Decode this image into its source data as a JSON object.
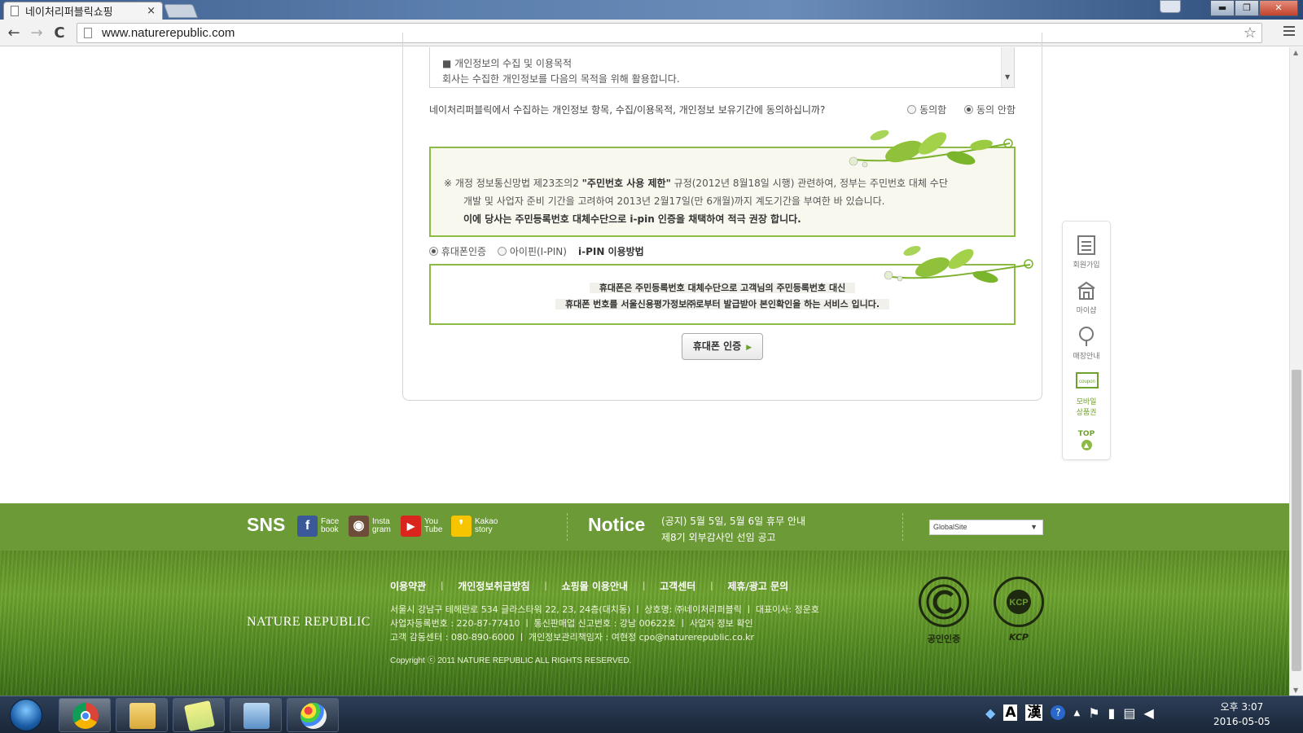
{
  "browser": {
    "tab_title": "네이처리퍼블릭쇼핑",
    "tab_close": "×",
    "url": "www.naturerepublic.com",
    "back": "←",
    "forward": "→",
    "reload": "C",
    "star": "☆"
  },
  "window": {
    "minimize": "▬",
    "maximize": "❐",
    "close": "✕"
  },
  "terms": {
    "heading": "■ 개인정보의 수집 및 이용목적",
    "body": "회사는 수집한 개인정보를 다음의 목적을 위해 활용합니다."
  },
  "agreement": {
    "question": "네이처리퍼블릭에서 수집하는 개인정보 항목, 수집/이용목적, 개인정보 보유기간에 동의하십니까?",
    "agree_label": "동의함",
    "disagree_label": "동의 안함",
    "selected": "disagree"
  },
  "notice_box": {
    "line1_prefix": "※ 개정 정보통신망법 제23조의2 ",
    "line1_bold": "\"주민번호 사용 제한\"",
    "line1_suffix": " 규정(2012년 8월18일 시행) 관련하여, 정부는 주민번호 대체 수단",
    "line2": "개발 및 사업자 준비 기간을 고려하여 2013년 2월17일(만 6개월)까지 계도기간을 부여한 바 있습니다.",
    "line3": "이에 당사는 주민등록번호 대체수단으로 i-pin 인증을 채택하여 적극 권장 합니다."
  },
  "methods": {
    "phone_label": "휴대폰인증",
    "ipin_label": "아이핀(I-PIN)",
    "guide_link": "i-PIN 이용방법",
    "selected": "phone"
  },
  "phone_box": {
    "line1": "휴대폰은 주민등록번호 대체수단으로 고객님의 주민등록번호 대신",
    "line2": "휴대폰 번호를 서울신용평가정보㈜로부터 발급받아 본인확인을 하는 서비스 입니다."
  },
  "auth_button": {
    "label": "휴대폰 인증",
    "arrow": "▶"
  },
  "quickbar": {
    "items": [
      {
        "label": "회원가입",
        "icon": "list-icon"
      },
      {
        "label": "마이샵",
        "icon": "store-icon"
      },
      {
        "label": "매장안내",
        "icon": "tree-icon"
      },
      {
        "label": "모바일\n상품권",
        "icon": "coupon-icon",
        "coupon_text": "coupon"
      }
    ],
    "top_label": "TOP",
    "top_arrow": "▲"
  },
  "footer": {
    "sns_title": "SNS",
    "sns": [
      {
        "name": "facebook",
        "glyph": "f",
        "text1": "Face",
        "text2": "book",
        "color": "#3b5998"
      },
      {
        "name": "instagram",
        "glyph": "◉",
        "text1": "Insta",
        "text2": "gram",
        "color": "#6e4c3a"
      },
      {
        "name": "youtube",
        "glyph": "▶",
        "text1": "You",
        "text2": "Tube",
        "color": "#d9251d"
      },
      {
        "name": "kakaostory",
        "glyph": "❜",
        "text1": "Kakao",
        "text2": "story",
        "color": "#f6c500"
      }
    ],
    "notice_title": "Notice",
    "notices": [
      "(공지) 5월 5일, 5월 6일 휴무 안내",
      "제8기 외부감사인 선임 공고"
    ],
    "global_site": "GlobalSite",
    "global_arrow": "▼",
    "brand": "NATURE REPUBLIC",
    "links": [
      "이용약관",
      "개인정보취급방침",
      "쇼핑몰 이용안내",
      "고객센터",
      "제휴/광고 문의"
    ],
    "info_lines": [
      "서울시 강남구 테헤란로 534 글라스타워 22, 23, 24층(대치동) ㅣ 상호명: ㈜네이처리퍼블릭 ㅣ 대표이사: 정운호",
      "사업자등록번호 : 220-87-77410 ㅣ 통신판매업 신고번호 : 강남 00622호 ㅣ 사업자 정보 확인",
      "고객 감동센터 : 080-890-6000 ㅣ 개인정보관리책임자 : 여현정 cpo@naturerepublic.co.kr"
    ],
    "copyright": "Copyright ⓒ 2011 NATURE REPUBLIC ALL RIGHTS RESERVED.",
    "seal1_caption": "공인인증",
    "seal2_text": "KCP",
    "seal2_caption": "KCP"
  },
  "taskbar": {
    "ime_a": "A",
    "ime_han": "漢",
    "help": "?",
    "time": "오후 3:07",
    "date": "2016-05-05"
  }
}
